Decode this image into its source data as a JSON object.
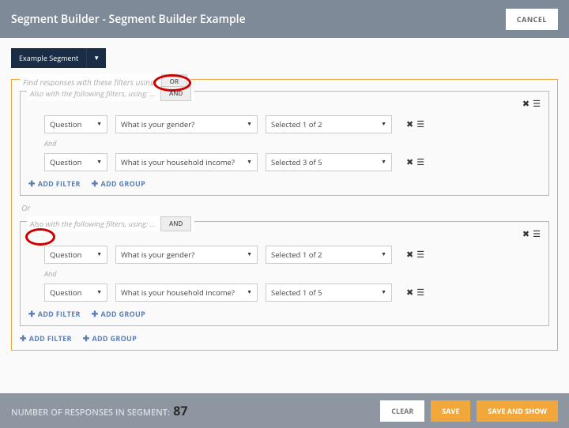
{
  "header": {
    "title": "Segment Builder - Segment Builder Example",
    "cancel": "CANCEL"
  },
  "segment": {
    "name": "Example Segment"
  },
  "outer": {
    "legend": "Find responses with these filters using:",
    "logic": "OR"
  },
  "groups": [
    {
      "legend": "Also with the following filters, using: …",
      "logic": "AND",
      "rows": [
        {
          "type": "Question",
          "question": "What is your gender?",
          "value": "Selected 1 of 2"
        },
        {
          "type": "Question",
          "question": "What is your household income?",
          "value": "Selected 3 of 5"
        }
      ],
      "conj": "And"
    },
    {
      "legend": "Also with the following filters, using: …",
      "logic": "AND",
      "rows": [
        {
          "type": "Question",
          "question": "What is your gender?",
          "value": "Selected 1 of 2"
        },
        {
          "type": "Question",
          "question": "What is your household income?",
          "value": "Selected 1 of 5"
        }
      ],
      "conj": "And"
    }
  ],
  "between": "Or",
  "links": {
    "addFilter": "ADD FILTER",
    "addGroup": "ADD GROUP"
  },
  "footer": {
    "label": "NUMBER OF RESPONSES IN SEGMENT:",
    "count": "87",
    "clear": "CLEAR",
    "save": "SAVE",
    "saveShow": "SAVE AND SHOW"
  }
}
